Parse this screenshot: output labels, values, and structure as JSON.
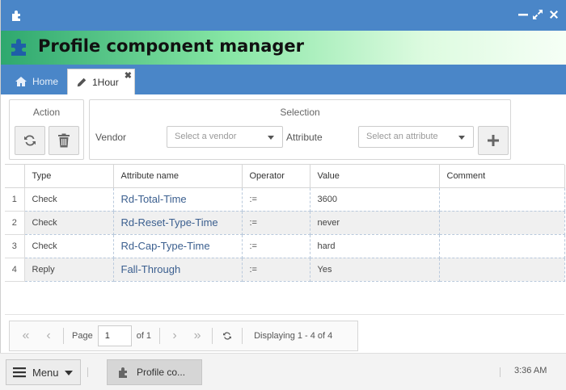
{
  "window": {
    "app_icon": "puzzle-icon",
    "controls": [
      "minimize-icon",
      "maximize-icon",
      "close-icon"
    ]
  },
  "banner": {
    "icon": "puzzle-icon",
    "title": "Profile component manager"
  },
  "tabs": [
    {
      "label": "Home",
      "icon": "home-icon",
      "active": false
    },
    {
      "label": "1Hour",
      "icon": "pencil-icon",
      "active": true,
      "close": "✖"
    }
  ],
  "toolbar": {
    "action_legend": "Action",
    "refresh_icon": "refresh-icon",
    "delete_icon": "trash-icon",
    "selection_legend": "Selection",
    "vendor_label": "Vendor",
    "vendor_placeholder": "Select a vendor",
    "attribute_label": "Attribute",
    "attribute_placeholder": "Select an attribute",
    "add_icon": "plus-icon"
  },
  "grid": {
    "columns": [
      "Type",
      "Attribute name",
      "Operator",
      "Value",
      "Comment"
    ],
    "rows": [
      {
        "n": "1",
        "type": "Check",
        "attribute": "Rd-Total-Time",
        "operator": ":=",
        "value": "3600",
        "comment": ""
      },
      {
        "n": "2",
        "type": "Check",
        "attribute": "Rd-Reset-Type-Time",
        "operator": ":=",
        "value": "never",
        "comment": ""
      },
      {
        "n": "3",
        "type": "Check",
        "attribute": "Rd-Cap-Type-Time",
        "operator": ":=",
        "value": "hard",
        "comment": ""
      },
      {
        "n": "4",
        "type": "Reply",
        "attribute": "Fall-Through",
        "operator": ":=",
        "value": "Yes",
        "comment": ""
      }
    ]
  },
  "pager": {
    "page_label": "Page",
    "page_value": "1",
    "of_label": "of 1",
    "status": "Displaying 1 - 4 of 4"
  },
  "taskbar": {
    "menu_label": "Menu",
    "task_label": "Profile co...",
    "clock": "3:36 AM"
  },
  "colors": {
    "titlebar": "#4a86c8",
    "banner_start": "#2ea86e",
    "attr_text": "#3b5f8f"
  }
}
